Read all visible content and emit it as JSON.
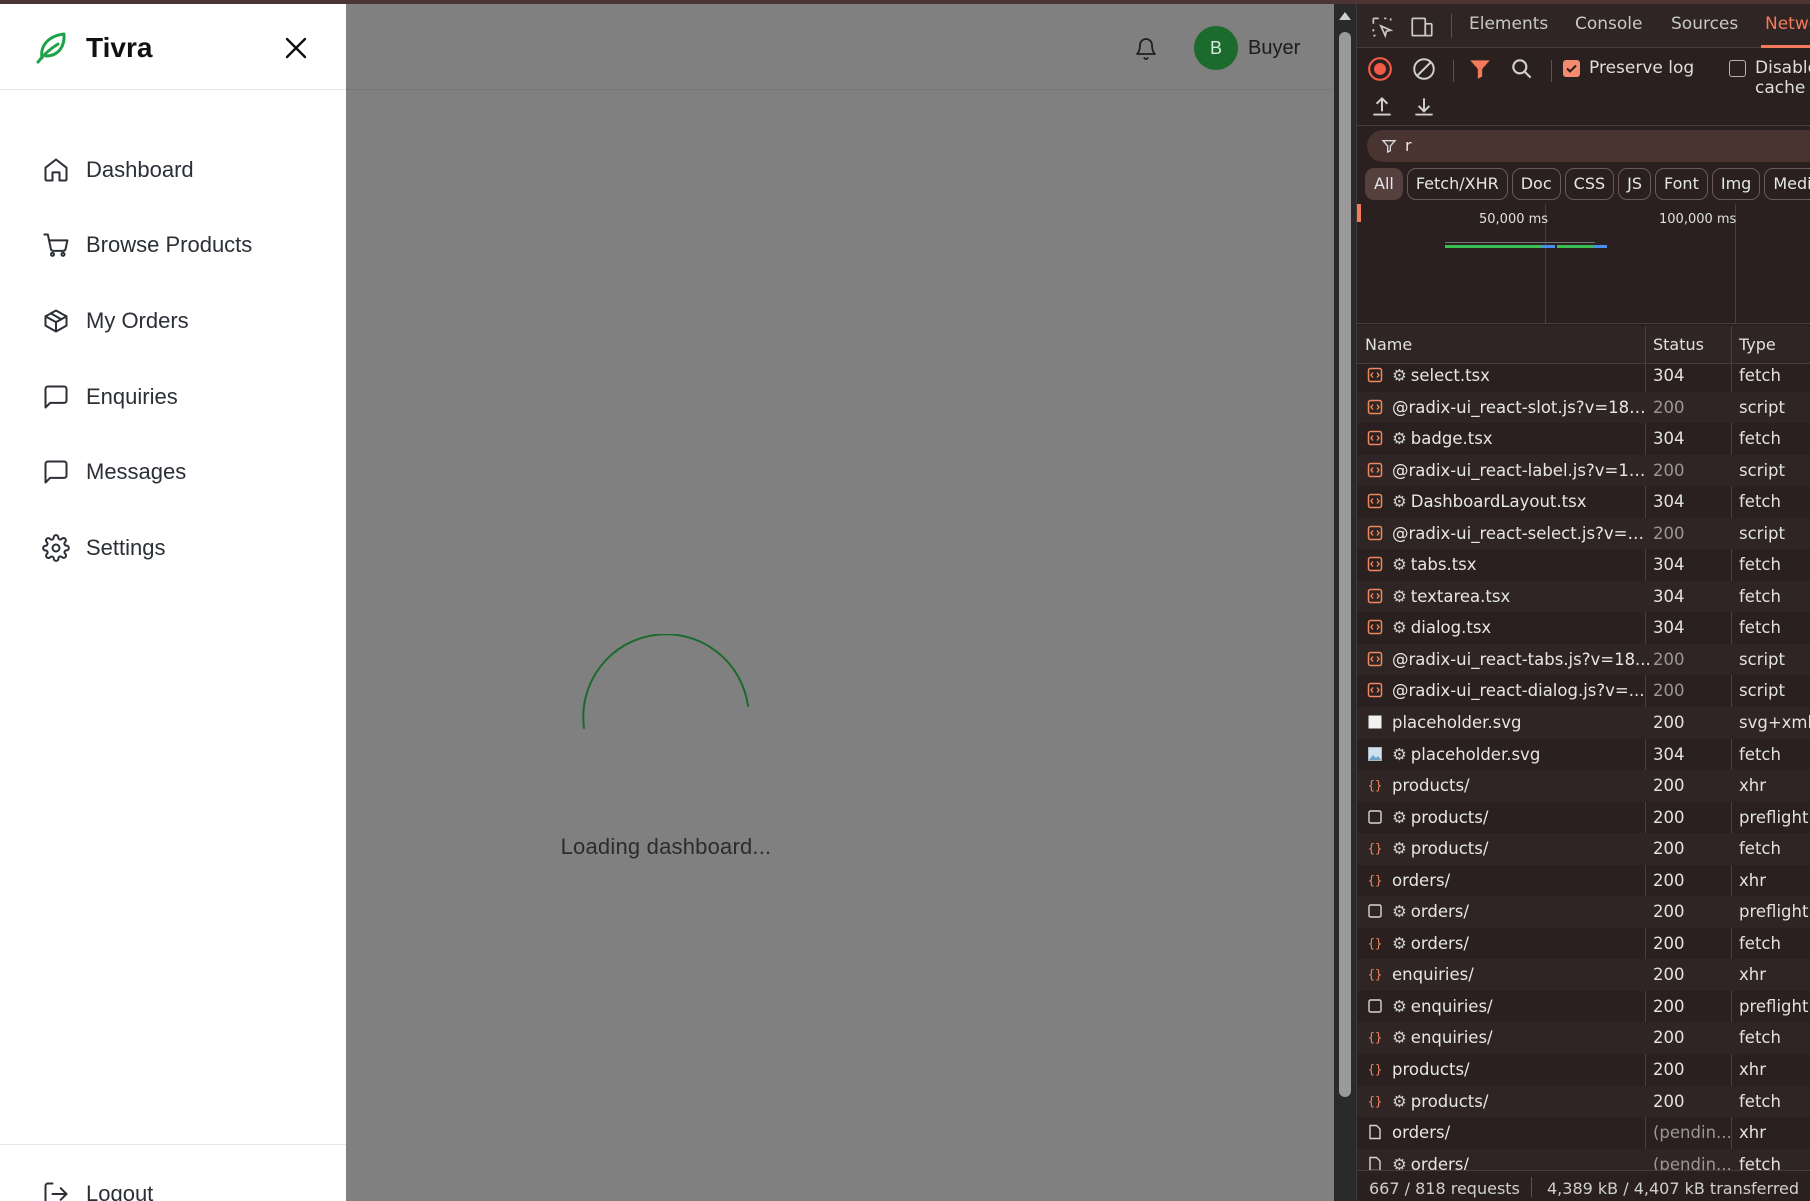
{
  "app": {
    "brand": "Tivra",
    "user": {
      "initial": "B",
      "name": "Buyer"
    },
    "loading_text": "Loading dashboard...",
    "accent": "#1a6b2c",
    "nav": [
      {
        "label": "Dashboard",
        "icon": "home-icon"
      },
      {
        "label": "Browse Products",
        "icon": "cart-icon"
      },
      {
        "label": "My Orders",
        "icon": "package-icon"
      },
      {
        "label": "Enquiries",
        "icon": "message-square-icon"
      },
      {
        "label": "Messages",
        "icon": "message-square-icon"
      },
      {
        "label": "Settings",
        "icon": "gear-icon"
      }
    ],
    "logout_label": "Logout"
  },
  "devtools": {
    "tabs": [
      "Elements",
      "Console",
      "Sources",
      "Network"
    ],
    "active_tab": "Network",
    "preserve_log": "Preserve log",
    "disable_cache": "Disable cache",
    "filter_text": "r",
    "type_filters": [
      "All",
      "Fetch/XHR",
      "Doc",
      "CSS",
      "JS",
      "Font",
      "Img",
      "Media"
    ],
    "active_filter": "All",
    "timeline_labels": [
      "50,000 ms",
      "100,000 ms"
    ],
    "columns": {
      "name": "Name",
      "status": "Status",
      "type": "Type"
    },
    "requests": [
      {
        "name": "select.tsx",
        "gear": true,
        "status": "304",
        "type": "fetch",
        "icon": "script"
      },
      {
        "name": "@radix-ui_react-slot.js?v=183...",
        "gear": false,
        "status": "200",
        "type": "script",
        "icon": "script",
        "dim": true
      },
      {
        "name": "badge.tsx",
        "gear": true,
        "status": "304",
        "type": "fetch",
        "icon": "script"
      },
      {
        "name": "@radix-ui_react-label.js?v=18...",
        "gear": false,
        "status": "200",
        "type": "script",
        "icon": "script",
        "dim": true
      },
      {
        "name": "DashboardLayout.tsx",
        "gear": true,
        "status": "304",
        "type": "fetch",
        "icon": "script"
      },
      {
        "name": "@radix-ui_react-select.js?v=1...",
        "gear": false,
        "status": "200",
        "type": "script",
        "icon": "script",
        "dim": true
      },
      {
        "name": "tabs.tsx",
        "gear": true,
        "status": "304",
        "type": "fetch",
        "icon": "script"
      },
      {
        "name": "textarea.tsx",
        "gear": true,
        "status": "304",
        "type": "fetch",
        "icon": "script"
      },
      {
        "name": "dialog.tsx",
        "gear": true,
        "status": "304",
        "type": "fetch",
        "icon": "script"
      },
      {
        "name": "@radix-ui_react-tabs.js?v=18...",
        "gear": false,
        "status": "200",
        "type": "script",
        "icon": "script",
        "dim": true
      },
      {
        "name": "@radix-ui_react-dialog.js?v=...",
        "gear": false,
        "status": "200",
        "type": "script",
        "icon": "script",
        "dim": true
      },
      {
        "name": "placeholder.svg",
        "gear": false,
        "status": "200",
        "type": "svg+xml",
        "icon": "white"
      },
      {
        "name": "placeholder.svg",
        "gear": true,
        "status": "304",
        "type": "fetch",
        "icon": "image"
      },
      {
        "name": "products/",
        "gear": false,
        "status": "200",
        "type": "xhr",
        "icon": "xhr"
      },
      {
        "name": "products/",
        "gear": true,
        "status": "200",
        "type": "preflight",
        "icon": "box"
      },
      {
        "name": "products/",
        "gear": true,
        "status": "200",
        "type": "fetch",
        "icon": "xhr"
      },
      {
        "name": "orders/",
        "gear": false,
        "status": "200",
        "type": "xhr",
        "icon": "xhr"
      },
      {
        "name": "orders/",
        "gear": true,
        "status": "200",
        "type": "preflight",
        "icon": "box"
      },
      {
        "name": "orders/",
        "gear": true,
        "status": "200",
        "type": "fetch",
        "icon": "xhr"
      },
      {
        "name": "enquiries/",
        "gear": false,
        "status": "200",
        "type": "xhr",
        "icon": "xhr"
      },
      {
        "name": "enquiries/",
        "gear": true,
        "status": "200",
        "type": "preflight",
        "icon": "box"
      },
      {
        "name": "enquiries/",
        "gear": true,
        "status": "200",
        "type": "fetch",
        "icon": "xhr"
      },
      {
        "name": "products/",
        "gear": false,
        "status": "200",
        "type": "xhr",
        "icon": "xhr"
      },
      {
        "name": "products/",
        "gear": true,
        "status": "200",
        "type": "fetch",
        "icon": "xhr"
      },
      {
        "name": "orders/",
        "gear": false,
        "status": "(pendin...",
        "type": "xhr",
        "icon": "doc",
        "dim": true
      },
      {
        "name": "orders/",
        "gear": true,
        "status": "(pendin...",
        "type": "fetch",
        "icon": "doc",
        "dim": true
      }
    ],
    "summary": {
      "requests": "667 / 818 requests",
      "transferred": "4,389 kB / 4,407 kB transferred"
    }
  }
}
